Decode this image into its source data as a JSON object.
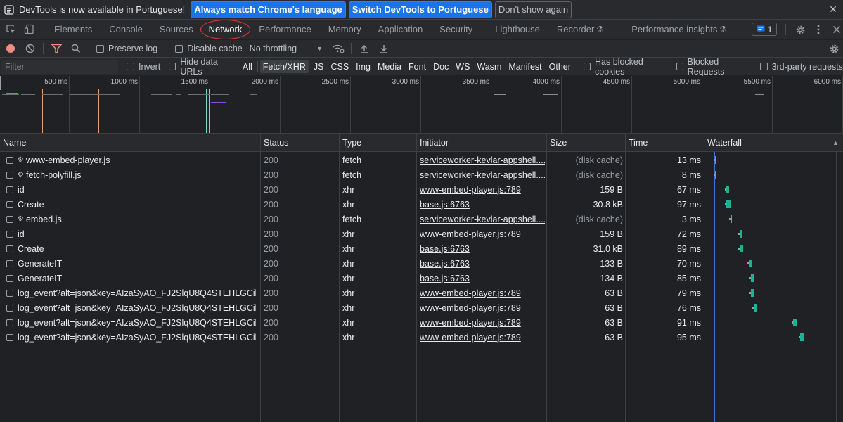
{
  "infobar": {
    "message": "DevTools is now available in Portuguese!",
    "btn_match": "Always match Chrome's language",
    "btn_switch": "Switch DevTools to Portuguese",
    "btn_dismiss": "Don't show again",
    "close": "✕"
  },
  "tabs": [
    {
      "label": "Elements"
    },
    {
      "label": "Console"
    },
    {
      "label": "Sources"
    },
    {
      "label": "Network"
    },
    {
      "label": "Performance"
    },
    {
      "label": "Memory"
    },
    {
      "label": "Application"
    },
    {
      "label": "Security"
    },
    {
      "label": "Lighthouse"
    },
    {
      "label": "Recorder"
    },
    {
      "label": "Performance insights"
    }
  ],
  "issues_count": "1",
  "toolbar": {
    "preserve_log": "Preserve log",
    "disable_cache": "Disable cache",
    "throttling": "No throttling"
  },
  "filter": {
    "placeholder": "Filter",
    "invert": "Invert",
    "hide_data_urls": "Hide data URLs",
    "types": [
      "All",
      "Fetch/XHR",
      "JS",
      "CSS",
      "Img",
      "Media",
      "Font",
      "Doc",
      "WS",
      "Wasm",
      "Manifest",
      "Other"
    ],
    "active_type": "Fetch/XHR",
    "has_blocked_cookies": "Has blocked cookies",
    "blocked_requests": "Blocked Requests",
    "third_party": "3rd-party requests"
  },
  "overview": {
    "ticks": [
      "500 ms",
      "1000 ms",
      "1500 ms",
      "2000 ms",
      "2500 ms",
      "3000 ms",
      "3500 ms",
      "4000 ms",
      "4500 ms",
      "5000 ms",
      "5500 ms",
      "6000 ms"
    ]
  },
  "columns": {
    "name": "Name",
    "status": "Status",
    "type": "Type",
    "initiator": "Initiator",
    "size": "Size",
    "time": "Time",
    "waterfall": "Waterfall"
  },
  "colors": {
    "accent_blue": "#1a73e8",
    "record_red": "#f28b82",
    "waterfall_green": "#1ab394",
    "waterfall_blue": "#4f9ef8",
    "load_line": "#e46962",
    "dcl_line": "#3f6fd9"
  },
  "requests": [
    {
      "name": "www-embed-player.js",
      "sw": true,
      "status": "200",
      "type": "fetch",
      "initiator": "serviceworker-kevlar-appshell....",
      "size": "(disk cache)",
      "time": "13 ms",
      "wf_start": 0.15,
      "wf_len": 0.1,
      "wf_color": "blue"
    },
    {
      "name": "fetch-polyfill.js",
      "sw": true,
      "status": "200",
      "type": "fetch",
      "initiator": "serviceworker-kevlar-appshell....",
      "size": "(disk cache)",
      "time": "8 ms",
      "wf_start": 0.15,
      "wf_len": 0.1,
      "wf_color": "blue"
    },
    {
      "name": "id",
      "sw": false,
      "status": "200",
      "type": "xhr",
      "initiator": "www-embed-player.js:789",
      "size": "159 B",
      "time": "67 ms",
      "wf_start": 0.39,
      "wf_len": 0.52,
      "wf_color": "green"
    },
    {
      "name": "Create",
      "sw": false,
      "status": "200",
      "type": "xhr",
      "initiator": "base.js:6763",
      "size": "30.8 kB",
      "time": "97 ms",
      "wf_start": 0.39,
      "wf_len": 0.7,
      "wf_color": "green"
    },
    {
      "name": "embed.js",
      "sw": true,
      "status": "200",
      "type": "fetch",
      "initiator": "serviceworker-kevlar-appshell....",
      "size": "(disk cache)",
      "time": "3 ms",
      "wf_start": 0.47,
      "wf_len": 0.05,
      "wf_color": "blue"
    },
    {
      "name": "id",
      "sw": false,
      "status": "200",
      "type": "xhr",
      "initiator": "www-embed-player.js:789",
      "size": "159 B",
      "time": "72 ms",
      "wf_start": 0.65,
      "wf_len": 0.55,
      "wf_color": "green"
    },
    {
      "name": "Create",
      "sw": false,
      "status": "200",
      "type": "xhr",
      "initiator": "base.js:6763",
      "size": "31.0 kB",
      "time": "89 ms",
      "wf_start": 0.65,
      "wf_len": 0.65,
      "wf_color": "green"
    },
    {
      "name": "GenerateIT",
      "sw": false,
      "status": "200",
      "type": "xhr",
      "initiator": "base.js:6763",
      "size": "133 B",
      "time": "70 ms",
      "wf_start": 0.84,
      "wf_len": 0.53,
      "wf_color": "green"
    },
    {
      "name": "GenerateIT",
      "sw": false,
      "status": "200",
      "type": "xhr",
      "initiator": "base.js:6763",
      "size": "134 B",
      "time": "85 ms",
      "wf_start": 0.88,
      "wf_len": 0.63,
      "wf_color": "green"
    },
    {
      "name": "log_event?alt=json&key=AIzaSyAO_FJ2SlqU8Q4STEHLGCil...",
      "sw": false,
      "status": "200",
      "type": "xhr",
      "initiator": "www-embed-player.js:789",
      "size": "63 B",
      "time": "79 ms",
      "wf_start": 0.88,
      "wf_len": 0.58,
      "wf_color": "green"
    },
    {
      "name": "log_event?alt=json&key=AIzaSyAO_FJ2SlqU8Q4STEHLGCil...",
      "sw": false,
      "status": "200",
      "type": "xhr",
      "initiator": "www-embed-player.js:789",
      "size": "63 B",
      "time": "76 ms",
      "wf_start": 0.94,
      "wf_len": 0.56,
      "wf_color": "green"
    },
    {
      "name": "log_event?alt=json&key=AIzaSyAO_FJ2SlqU8Q4STEHLGCil...",
      "sw": false,
      "status": "200",
      "type": "xhr",
      "initiator": "www-embed-player.js:789",
      "size": "63 B",
      "time": "91 ms",
      "wf_start": 1.74,
      "wf_len": 0.68,
      "wf_color": "green"
    },
    {
      "name": "log_event?alt=json&key=AIzaSyAO_FJ2SlqU8Q4STEHLGCil...",
      "sw": false,
      "status": "200",
      "type": "xhr",
      "initiator": "www-embed-player.js:789",
      "size": "63 B",
      "time": "95 ms",
      "wf_start": 1.88,
      "wf_len": 0.71,
      "wf_color": "green"
    }
  ]
}
